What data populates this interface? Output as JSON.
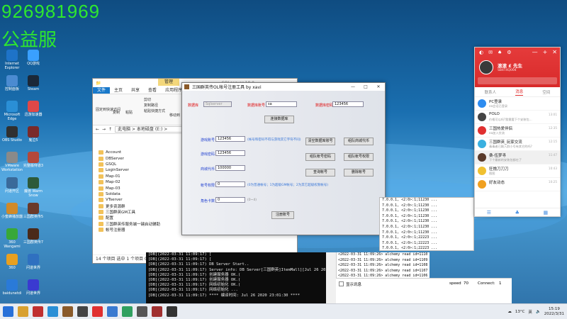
{
  "overlay": {
    "number": "926981969",
    "server": "公益服"
  },
  "desktop_icons": [
    {
      "label": "Internet Explorer",
      "color": "#1e73c8"
    },
    {
      "label": "QQ游戏",
      "color": "#3aa0ff"
    },
    {
      "label": "控制面板",
      "color": "#4b8bd1"
    },
    {
      "label": "Steam",
      "color": "#1b2838"
    },
    {
      "label": "Microsoft Edge",
      "color": "#2a8fd6"
    },
    {
      "label": "迅游加速器",
      "color": "#e04848"
    },
    {
      "label": "OBS Studio",
      "color": "#303030"
    },
    {
      "label": "鬼泣5",
      "color": "#7a2a2a"
    },
    {
      "label": "VMware Workstation",
      "color": "#8a8a8a"
    },
    {
      "label": "完整版侍道3",
      "color": "#b3483a"
    },
    {
      "label": "问道开区",
      "color": "#3a6a9a"
    },
    {
      "label": "魔兽 Warm Snow",
      "color": "#2d5a3a"
    },
    {
      "label": "小蜜蜂播放器",
      "color": "#d08a2a"
    },
    {
      "label": "三国群英传5",
      "color": "#6a3a2a"
    },
    {
      "label": "360 Wangami",
      "color": "#38a838"
    },
    {
      "label": "三国群英传7",
      "color": "#4a2a1a"
    },
    {
      "label": "360",
      "color": "#e8a020"
    },
    {
      "label": "问道世界",
      "color": "#2f70c0"
    },
    {
      "label": "baidunetdi",
      "color": "#2a7ad8"
    },
    {
      "label": "问道世界",
      "color": "#3a3ad0"
    }
  ],
  "explorer": {
    "title": "SQLserver 10.0",
    "manage_tab": "管理",
    "tabs": [
      "文件",
      "主页",
      "共享",
      "查看",
      "应用程序工具"
    ],
    "ribbon": [
      "固定到快速访问",
      "复制",
      "粘贴",
      "剪切",
      "复制路径",
      "粘贴快捷方式",
      "移动到"
    ],
    "breadcrumb": "此电脑 > 本地磁盘 (E:) >",
    "files": [
      {
        "name": "Account",
        "date": "2022"
      },
      {
        "name": "DBServer",
        "date": "2022"
      },
      {
        "name": "GSQL",
        "date": "2022"
      },
      {
        "name": "LoginServer",
        "date": "2022"
      },
      {
        "name": "Map-01",
        "date": "2022"
      },
      {
        "name": "Map-02",
        "date": "2022"
      },
      {
        "name": "Map-03",
        "date": "2022"
      },
      {
        "name": "Soldata",
        "date": "2022"
      },
      {
        "name": "VTserver",
        "date": "2022"
      },
      {
        "name": "更多资源群",
        "date": "2022"
      },
      {
        "name": "三国群英GM工具",
        "date": "2022"
      },
      {
        "name": "配置",
        "date": "2022"
      },
      {
        "name": "三国群英传服务端一键启动辅助",
        "date": "2022"
      },
      {
        "name": "帐号注册器",
        "date": "2022"
      }
    ],
    "status": "14 个项目    选中 1 个项目  0.98 MB"
  },
  "tool": {
    "title": "三国群英传OL帐号注册工具 by xavi",
    "fields": {
      "db_name_label": "数据库",
      "db_name_value": "Sqlserver",
      "db_account_label": "数据库账号",
      "db_account_value": "sa",
      "db_password_label": "数据库密码",
      "db_password_value": "123456",
      "connect_button": "连接数据库",
      "account_label": "游戏账号",
      "account_value": "123456",
      "account_hint": "(帐号和密码不得与游戏其它字符不同)",
      "password_label": "游戏密码",
      "password_value": "123456",
      "mall_label": "商城代币",
      "mall_value": "100000",
      "perm_label": "帐号权限",
      "perm_value": "0",
      "perm_hint": "(0为普通帐号；1为超级GM帐号；2为其它超级权限帐号)",
      "card_label": "角色卡数",
      "card_value": "0",
      "card_hint": "(0~4)",
      "register_button": "注册账号"
    },
    "buttons": [
      "清空数据库账号",
      "组队商城代币",
      "组队帐号密码",
      "组队帐号权限",
      "查询帐号",
      "删除帐号"
    ]
  },
  "log_lines": [
    "[DB](2022-03-31 11:09:17) [",
    "[DB](2022-03-31 11:09:17) [",
    "[DB](2022-03-31 11:09:17) DB Server Start..",
    "[DB](2022-03-31 11:09:17) Server info: DB Server[三国群英]ItemMall][Jul 26 2020 23:01",
    "[DB](2022-03-31 11:09:17) 创建服务器 OK.(",
    "[DB](2022-03-31 11:09:17) 创建服务器 OK.(",
    "[DB](2022-03-31 11:09:17) 网络初始化 OK.(",
    "[DB](2022-03-31 11:09:17) 网络初始化 ...",
    "[DB](2022-03-31 11:09:17) **** 编译时间: Jul 26 2020 23:01:30 ****"
  ],
  "alchemy_lines": [
    "<2022-03-31 11:09:26> alchemy read id=1110",
    "<2022-03-31 11:09:26> alchemy read id=1109",
    "<2022-03-31 11:09:26> alchemy read id=1108",
    "<2022-03-31 11:09:26> alchemy read id=1107",
    "<2022-03-31 11:09:26> alchemy read id=1106"
  ],
  "right_panel_lines": [
    "7.0.0.1, <2:0>:1;11230 ...",
    "7.0.0.1, <2:0>:1;11230 ...",
    "7.0.0.1, <2:0>:1;11230 ...",
    "7.0.0.1, <2:0>:1;11230 ...",
    "7.0.0.1, <2:0>:1;11230 ...",
    "7.0.0.1, <2:0>:1;11230 ...",
    "7.0.0.1, <2:0>:1;11230 ...",
    "7.0.0.1, <2:0>:1;22223 ...",
    "7.0.0.1, <2:0>:1;22223 ...",
    "7.0.0.1, <2:0>:1;22223 ..."
  ],
  "sysbar": {
    "show_info": "显示讯息",
    "speed_label": "speed",
    "speed_value": "70",
    "connect_label": "Connect:",
    "connect_value": "1"
  },
  "qq": {
    "name": "滚滚 £ 先生",
    "sig": "SB4T4Q004",
    "tabs": [
      "联系人",
      "消息",
      "空间"
    ],
    "items": [
      {
        "name": "PC登录",
        "msg": "ea会话已登录",
        "time": "",
        "color": "#2d8cf0"
      },
      {
        "name": "POLO",
        "msg": "价格可以吗?我需要下个安装包...",
        "time": "13:01",
        "color": "#444"
      },
      {
        "name": "三国热爱伴侣",
        "msg": "ea加入交流",
        "time": "12:35",
        "color": "#e03030"
      },
      {
        "name": "三国群英_玩家交流",
        "msg": "毒毒者已踢入群小号有其它的吗?",
        "time": "12:15",
        "color": "#3ab0e0"
      },
      {
        "name": "桑-伍梦寻",
        "msg": "下个最新的安装包都在了",
        "time": "11:47",
        "color": "#5a3a2a"
      },
      {
        "name": "狂撸刀刀刀",
        "msg": "图图",
        "time": "10:43",
        "color": "#f0c030"
      },
      {
        "name": "好友动态",
        "msg": "",
        "time": "10:25",
        "color": "#f0a020"
      }
    ]
  },
  "taskbar": {
    "temp": "13°C",
    "lang": "英",
    "time": "15:19",
    "date": "2022/3/31"
  }
}
